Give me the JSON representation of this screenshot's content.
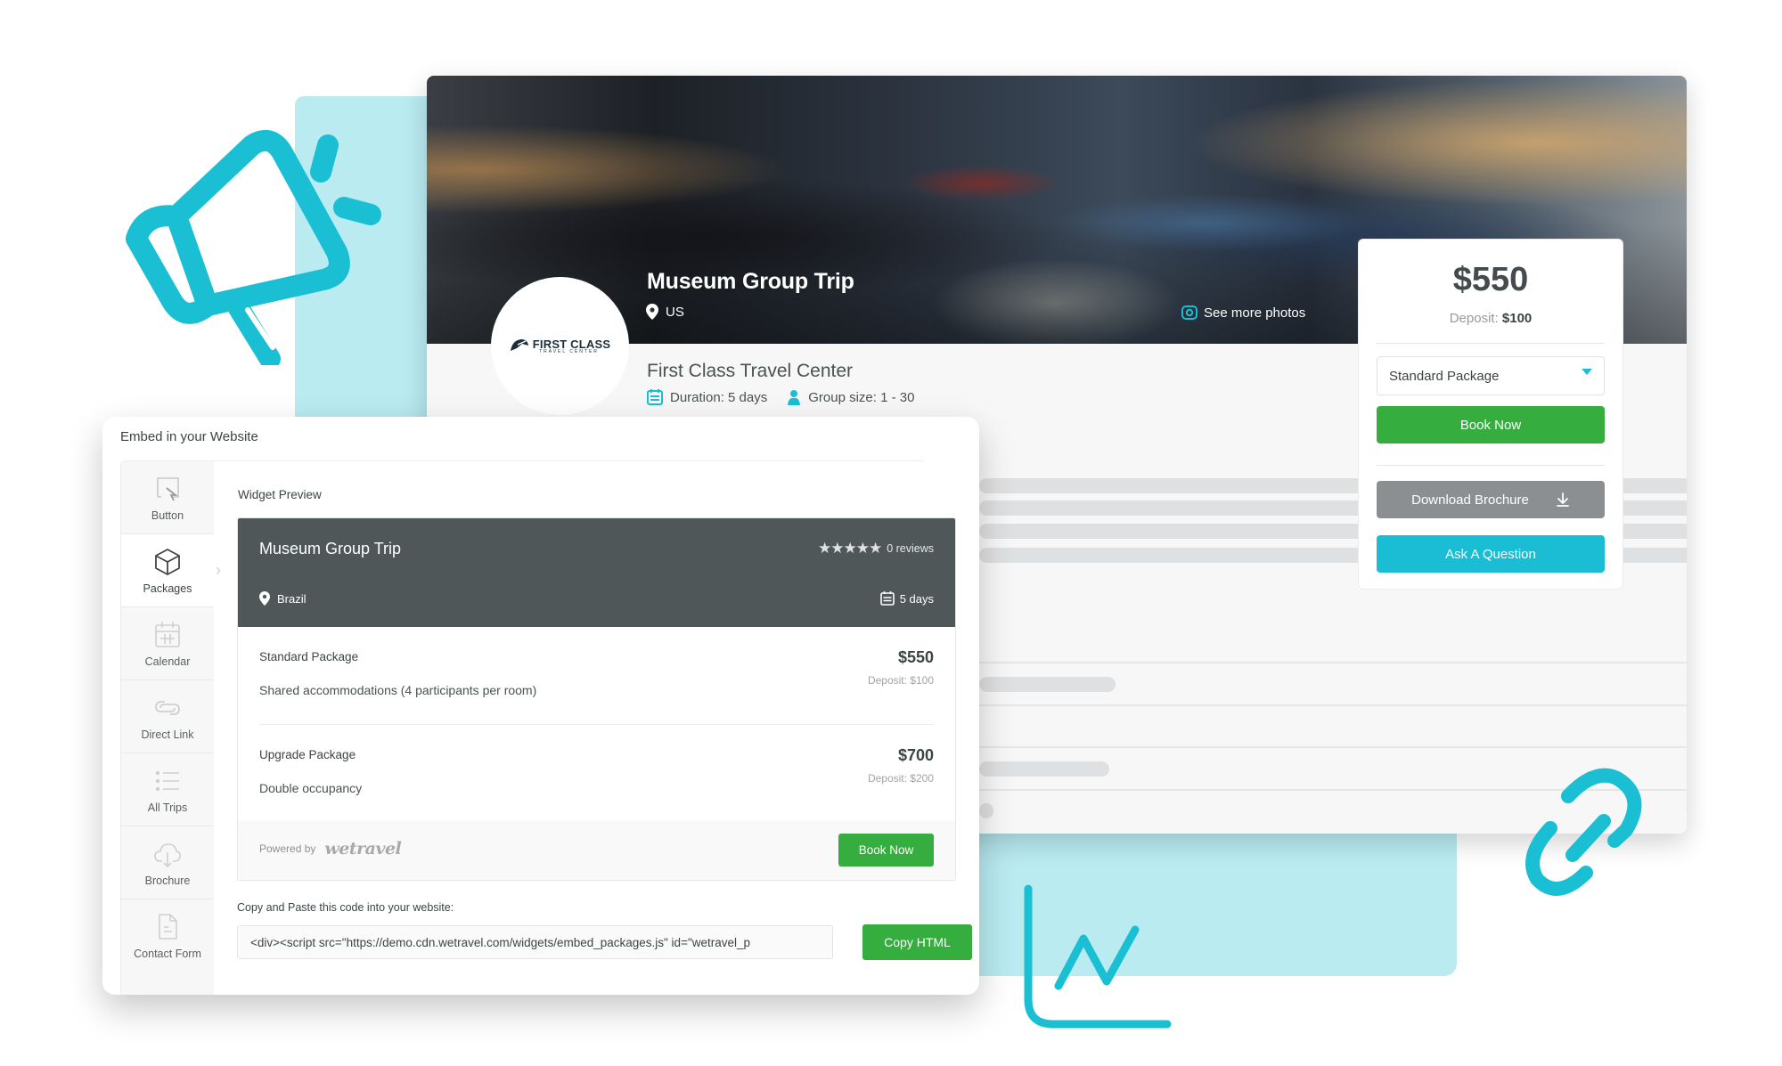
{
  "colors": {
    "accent_teal": "#1bbdd4",
    "light_teal": "#b9ebf1",
    "book_green": "#35ad3f",
    "brochure_gray": "#8c8f91",
    "widget_header": "#4f5758"
  },
  "trip_page": {
    "title": "Museum Group Trip",
    "location": "US",
    "see_more_photos": "See more photos",
    "logo": {
      "name": "FIRST CLASS",
      "subtitle": "TRAVEL CENTER"
    },
    "operator_name": "First Class Travel Center",
    "duration": "Duration: 5 days",
    "group_size": "Group size: 1 - 30"
  },
  "booking_card": {
    "price": "$550",
    "deposit_label": "Deposit:",
    "deposit_value": "$100",
    "package_select": "Standard Package",
    "book_now": "Book Now",
    "download_brochure": "Download Brochure",
    "ask_question": "Ask A Question"
  },
  "embed_panel": {
    "title": "Embed in your Website",
    "sidebar": [
      {
        "label": "Button",
        "icon": "cursor-click-icon"
      },
      {
        "label": "Packages",
        "icon": "cube-icon",
        "active": true
      },
      {
        "label": "Calendar",
        "icon": "calendar-icon"
      },
      {
        "label": "Direct Link",
        "icon": "link-icon"
      },
      {
        "label": "All Trips",
        "icon": "list-icon"
      },
      {
        "label": "Brochure",
        "icon": "cloud-download-icon"
      },
      {
        "label": "Contact Form",
        "icon": "document-icon"
      }
    ],
    "widget_preview_label": "Widget Preview",
    "widget": {
      "title": "Museum Group Trip",
      "rating_stars": 5,
      "reviews": "0 reviews",
      "location": "Brazil",
      "duration": "5 days",
      "packages": [
        {
          "name": "Standard Package",
          "description": "Shared accommodations (4 participants per room)",
          "price": "$550",
          "deposit": "Deposit: $100"
        },
        {
          "name": "Upgrade Package",
          "description": "Double occupancy",
          "price": "$700",
          "deposit": "Deposit: $200"
        }
      ],
      "powered_by": "Powered by",
      "brand": "wetravel",
      "book_now": "Book Now"
    },
    "code_label": "Copy and Paste this code into your website:",
    "code_value": "<div><script src=\"https://demo.cdn.wetravel.com/widgets/embed_packages.js\" id=\"wetravel_p",
    "copy_html": "Copy HTML"
  }
}
